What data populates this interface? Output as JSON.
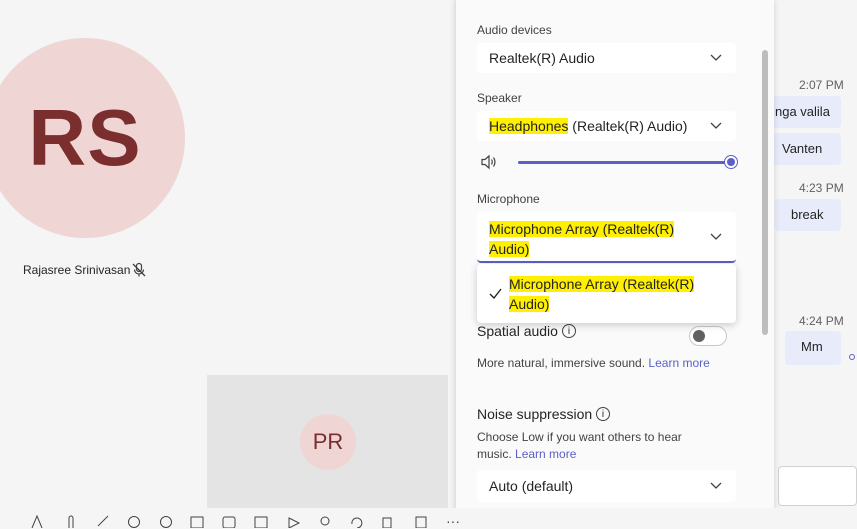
{
  "stage": {
    "main_participant": {
      "initials": "RS",
      "name": "Rajasree Srinivasan"
    },
    "secondary_participant": {
      "initials": "PR"
    }
  },
  "settings": {
    "audio_devices": {
      "label": "Audio devices",
      "value": "Realtek(R) Audio"
    },
    "speaker": {
      "label": "Speaker",
      "value_highlight": "Headphones",
      "value_rest": " (Realtek(R) Audio)",
      "volume": 1.0
    },
    "microphone": {
      "label": "Microphone",
      "value_line1": "Microphone Array (Realtek(R)",
      "value_line2": "Audio)",
      "menu_option_line1": "Microphone Array (Realtek(R)",
      "menu_option_line2": "Audio)"
    },
    "spatial_audio": {
      "label": "Spatial audio",
      "description": "More natural, immersive sound.",
      "link": "Learn more",
      "enabled": false
    },
    "noise_suppression": {
      "label": "Noise suppression",
      "description_line1": "Choose Low if you want others to hear",
      "description_line2": "music.",
      "link": "Learn more",
      "value": "Auto (default)"
    }
  },
  "chat": {
    "messages": [
      {
        "time": "2:07 PM",
        "texts": [
          "nga valila",
          "Vanten"
        ]
      },
      {
        "time": "4:23 PM",
        "texts": [
          "break"
        ]
      },
      {
        "time": "4:24 PM",
        "texts": [
          "Mm"
        ]
      }
    ]
  },
  "colors": {
    "accent": "#5b5fc7",
    "highlight": "#ffef00",
    "avatar_bg": "#f0d5d5",
    "avatar_text": "#7a2e2e"
  }
}
